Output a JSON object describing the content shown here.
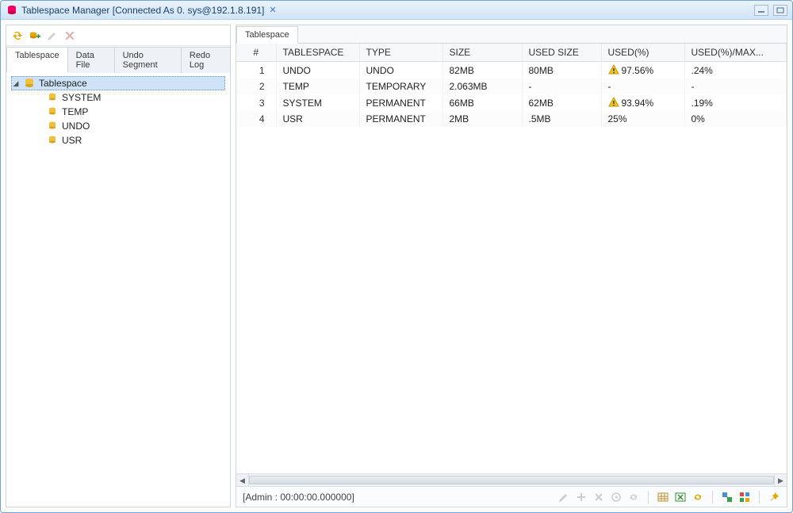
{
  "window": {
    "title": "Tablespace Manager [Connected As 0. sys@192.1.8.191]"
  },
  "leftToolbar": {
    "icons": [
      "refresh-all-icon",
      "clone-icon",
      "edit-icon",
      "delete-icon"
    ]
  },
  "leftTabs": {
    "items": [
      {
        "label": "Tablespace",
        "active": true
      },
      {
        "label": "Data File",
        "active": false
      },
      {
        "label": "Undo Segment",
        "active": false
      },
      {
        "label": "Redo Log",
        "active": false
      }
    ]
  },
  "tree": {
    "root": {
      "label": "Tablespace",
      "expanded": true
    },
    "children": [
      {
        "label": "SYSTEM"
      },
      {
        "label": "TEMP"
      },
      {
        "label": "UNDO"
      },
      {
        "label": "USR"
      }
    ]
  },
  "rightTabs": {
    "items": [
      {
        "label": "Tablespace",
        "active": true
      }
    ]
  },
  "grid": {
    "columns": [
      "#",
      "TABLESPACE",
      "TYPE",
      "SIZE",
      "USED SIZE",
      "USED(%)",
      "USED(%)/MAX..."
    ],
    "rows": [
      {
        "n": "1",
        "ts": "UNDO",
        "type": "UNDO",
        "size": "82MB",
        "used": "80MB",
        "pct": "97.56%",
        "warn": true,
        "pctmax": ".24%"
      },
      {
        "n": "2",
        "ts": "TEMP",
        "type": "TEMPORARY",
        "size": "2.063MB",
        "used": "-",
        "pct": "-",
        "warn": false,
        "pctmax": "-"
      },
      {
        "n": "3",
        "ts": "SYSTEM",
        "type": "PERMANENT",
        "size": "66MB",
        "used": "62MB",
        "pct": "93.94%",
        "warn": true,
        "pctmax": ".19%"
      },
      {
        "n": "4",
        "ts": "USR",
        "type": "PERMANENT",
        "size": "2MB",
        "used": ".5MB",
        "pct": "25%",
        "warn": false,
        "pctmax": "0%"
      }
    ]
  },
  "status": {
    "text": "[Admin : 00:00:00.000000]"
  }
}
